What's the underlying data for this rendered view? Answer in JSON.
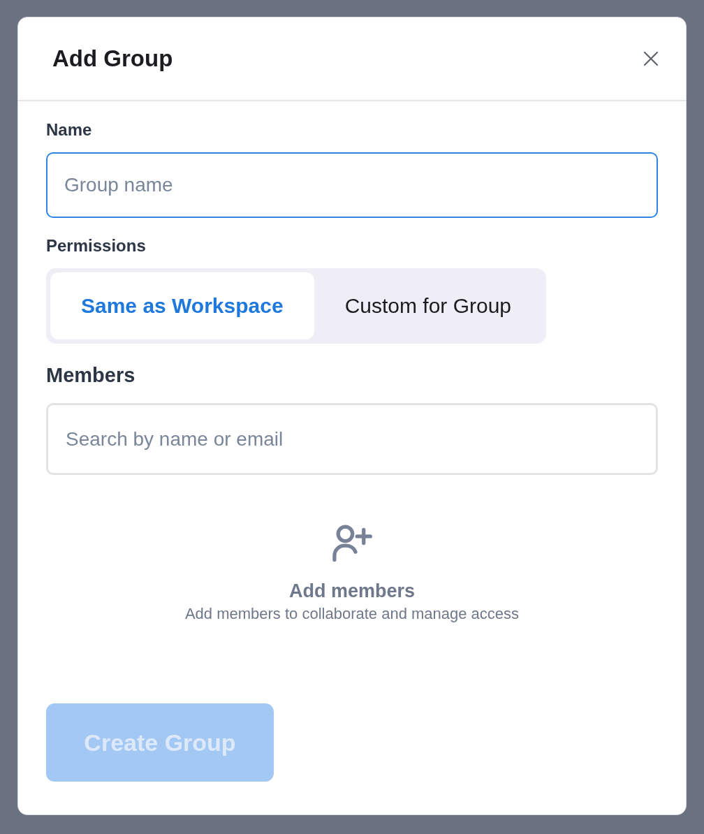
{
  "dialog": {
    "title": "Add Group"
  },
  "name_field": {
    "label": "Name",
    "placeholder": "Group name",
    "focused": true
  },
  "permissions": {
    "label": "Permissions",
    "options": [
      {
        "label": "Same as Workspace",
        "selected": true
      },
      {
        "label": "Custom for Group",
        "selected": false
      }
    ]
  },
  "members": {
    "label": "Members",
    "search": {
      "placeholder": "Search by name or email",
      "focused": false
    },
    "empty_state": {
      "title": "Add members",
      "text": "Add members to collaborate and manage access"
    }
  },
  "create_button": {
    "label": "Create Group",
    "disabled": true
  }
}
